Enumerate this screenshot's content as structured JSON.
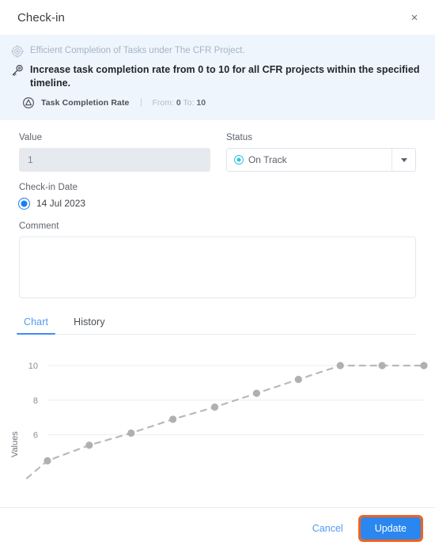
{
  "header": {
    "title": "Check-in",
    "close_label": "×"
  },
  "banner": {
    "objective_icon": "target-icon",
    "objective_text": "Efficient Completion of Tasks under The CFR Project.",
    "key_result_icon": "key-icon",
    "key_result_text": "Increase task completion rate from 0 to 10 for all CFR projects within the specified timeline.",
    "metric_icon": "metric-triangle-icon",
    "metric_name": "Task Completion Rate",
    "range_from_label": "From:",
    "range_from_value": "0",
    "range_to_label": "To:",
    "range_to_value": "10"
  },
  "form": {
    "value_label": "Value",
    "value_current": "1",
    "value_placeholder": "",
    "status_label": "Status",
    "status_selected": "On Track",
    "status_color": "#2bc4e0",
    "status_options": [
      "On Track"
    ],
    "checkin_date_label": "Check-in Date",
    "checkin_date_value": "14 Jul 2023",
    "comment_label": "Comment",
    "comment_value": "",
    "comment_placeholder": ""
  },
  "tabs": [
    {
      "label": "Chart",
      "active": true
    },
    {
      "label": "History",
      "active": false
    }
  ],
  "footer": {
    "cancel_label": "Cancel",
    "update_label": "Update",
    "update_color": "#2b87f0",
    "focus_ring_color": "#f2621f"
  },
  "chart_data": {
    "type": "line",
    "title": "",
    "xlabel": "",
    "ylabel": "Values",
    "ylim": [
      3.8,
      10.6
    ],
    "yticks": [
      6,
      8,
      10
    ],
    "ytick_labels": [
      "6",
      "8",
      "10"
    ],
    "grid": true,
    "legend": false,
    "line_style": "dashed",
    "line_color": "#b9b9b9",
    "marker_color": "#b0b0b0",
    "series": [
      {
        "name": "Values",
        "x": [
          1,
          2,
          3,
          4,
          5,
          6,
          7,
          8,
          9,
          10
        ],
        "values": [
          4.5,
          5.4,
          6.1,
          6.9,
          7.6,
          8.4,
          9.2,
          10.0,
          10.0,
          10.0
        ]
      }
    ]
  }
}
